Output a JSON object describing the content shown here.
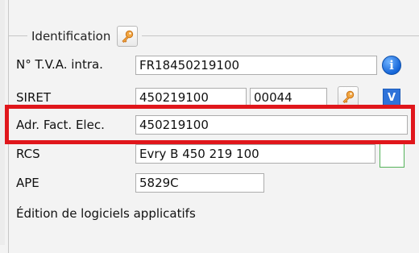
{
  "group": {
    "legend": "Identification"
  },
  "rows": {
    "tva": {
      "label": "N° T.V.A. intra.",
      "value": "FR18450219100"
    },
    "siret": {
      "label": "SIRET",
      "siren": "450219100",
      "nic": "00044"
    },
    "adr": {
      "label": "Adr. Fact. Elec.",
      "value": "450219100"
    },
    "rcs": {
      "label": "RCS",
      "value": "Evry B 450 219 100"
    },
    "ape": {
      "label": "APE",
      "value": "5829C"
    }
  },
  "buttons": {
    "info": "i",
    "v": "V"
  },
  "activity": "Édition de logiciels applicatifs",
  "colors": {
    "highlight": "#e0161b",
    "info_blue": "#1565d8",
    "key_orange": "#e58a1f",
    "green_border": "#55b35a"
  }
}
